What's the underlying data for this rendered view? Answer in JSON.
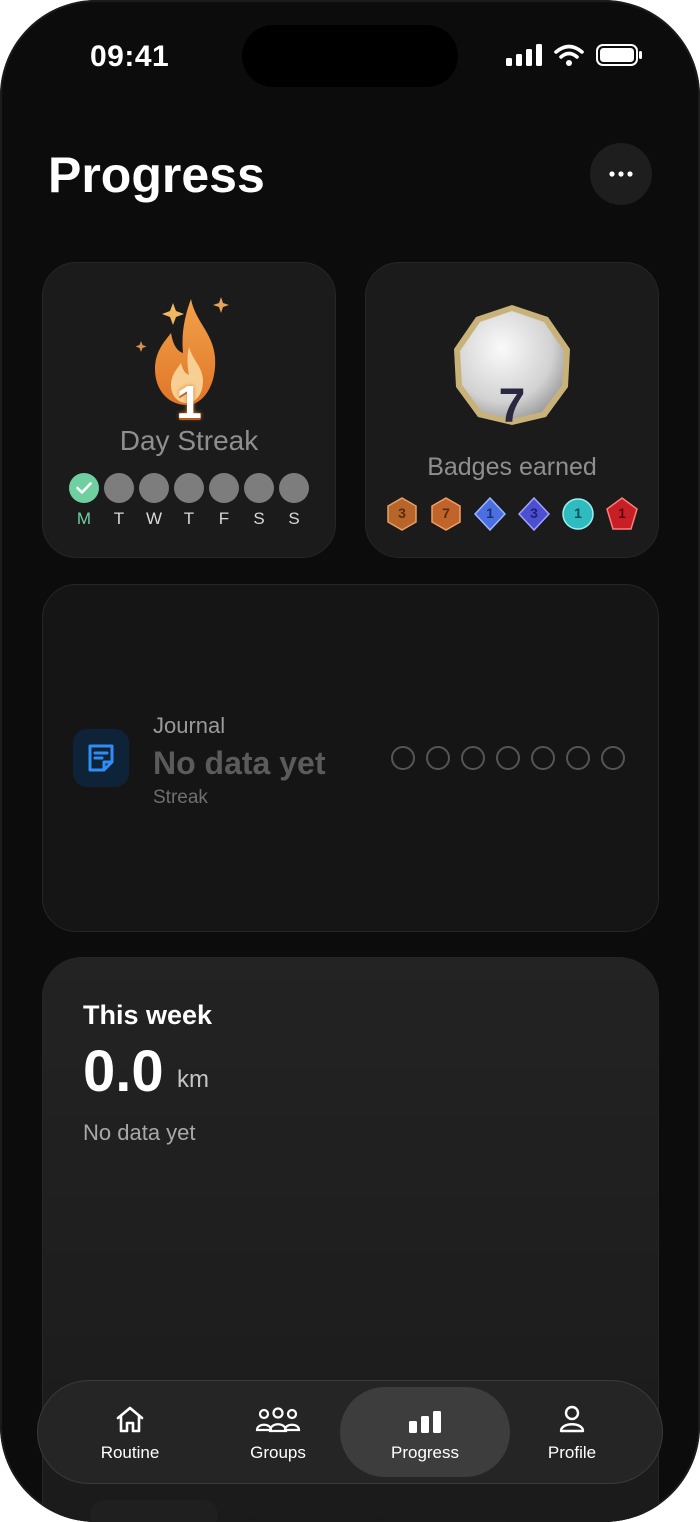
{
  "status": {
    "time": "09:41"
  },
  "page": {
    "title": "Progress"
  },
  "streak": {
    "count": "1",
    "label": "Day Streak",
    "days": [
      {
        "label": "M",
        "done": true
      },
      {
        "label": "T",
        "done": false
      },
      {
        "label": "W",
        "done": false
      },
      {
        "label": "T",
        "done": false
      },
      {
        "label": "F",
        "done": false
      },
      {
        "label": "S",
        "done": false
      },
      {
        "label": "S",
        "done": false
      }
    ]
  },
  "badges": {
    "count": "7",
    "label": "Badges earned",
    "items": [
      {
        "num": "3",
        "color": "#b8652a"
      },
      {
        "num": "7",
        "color": "#c0642b"
      },
      {
        "num": "1",
        "color": "#4a6fe0"
      },
      {
        "num": "3",
        "color": "#4b4fd0"
      },
      {
        "num": "1",
        "color": "#2fbcc0"
      },
      {
        "num": "1",
        "color": "#c81e25"
      }
    ]
  },
  "journal": {
    "label": "Journal",
    "value": "No data yet",
    "sub": "Streak"
  },
  "week": {
    "title": "This week",
    "value": "0.0",
    "unit": "km",
    "note": "No data yet"
  },
  "tabs": [
    {
      "label": "Routine",
      "icon": "house-icon"
    },
    {
      "label": "Groups",
      "icon": "people-icon"
    },
    {
      "label": "Progress",
      "icon": "bar-chart-icon",
      "active": true
    },
    {
      "label": "Profile",
      "icon": "person-icon"
    }
  ],
  "colors": {
    "accent_green": "#6fcfa0",
    "journal_blue": "#2f8df5",
    "background": "#0c0c0c"
  }
}
